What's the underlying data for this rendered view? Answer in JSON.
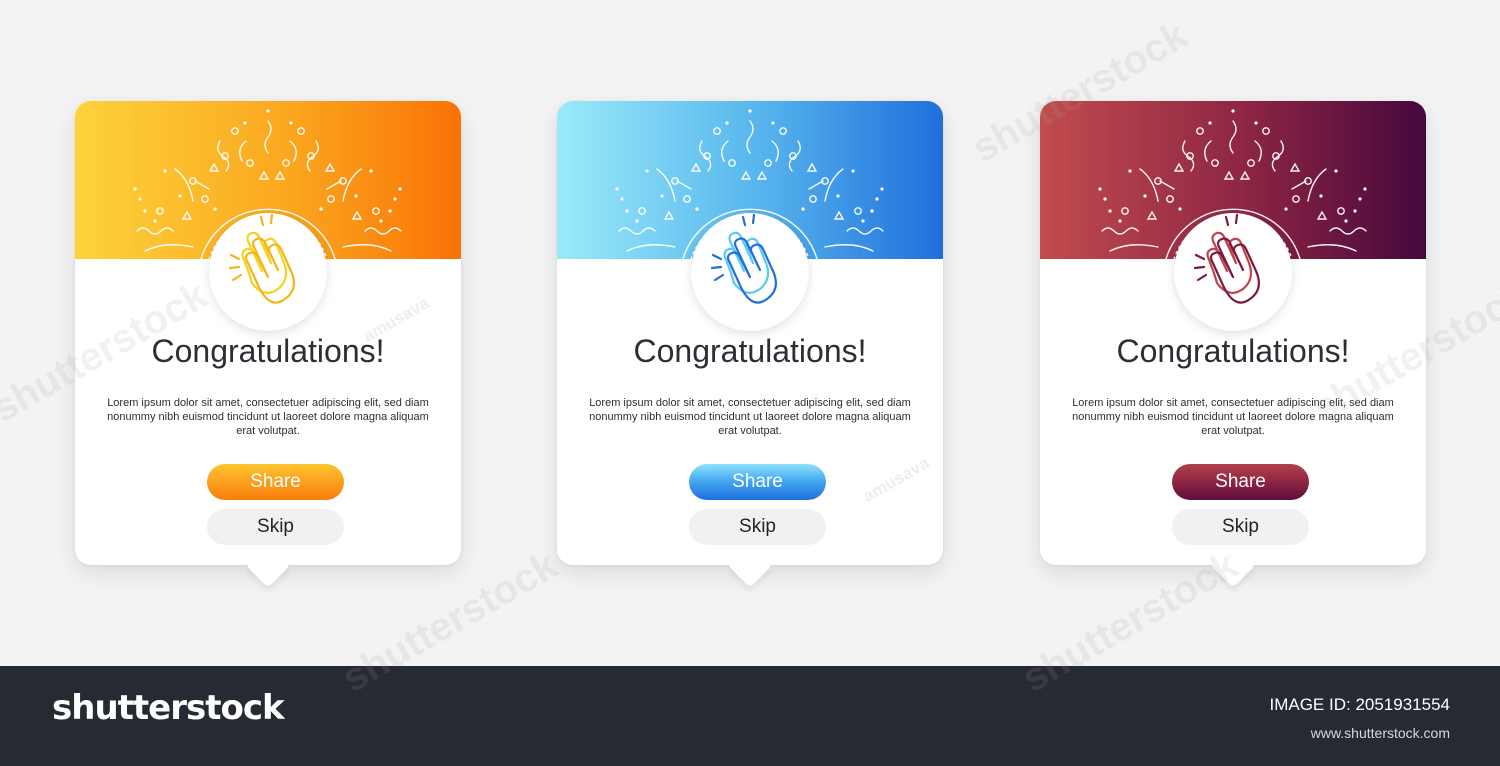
{
  "cards": [
    {
      "theme": "orange",
      "accent_colors": [
        "#fcd33b",
        "#f97206"
      ],
      "icon": "clapping-hands-icon",
      "title": "Congratulations!",
      "description": "Lorem ipsum dolor sit amet, consectetuer adipiscing elit, sed diam nonummy nibh euismod tincidunt ut laoreet dolore magna aliquam erat volutpat.",
      "share_label": "Share",
      "skip_label": "Skip"
    },
    {
      "theme": "blue",
      "accent_colors": [
        "#9aeaf8",
        "#1f6fdc"
      ],
      "icon": "clapping-hands-icon",
      "title": "Congratulations!",
      "description": "Lorem ipsum dolor sit amet, consectetuer adipiscing elit, sed diam nonummy nibh euismod tincidunt ut laoreet dolore magna aliquam erat volutpat.",
      "share_label": "Share",
      "skip_label": "Skip"
    },
    {
      "theme": "burgundy",
      "accent_colors": [
        "#c24c4e",
        "#45083d"
      ],
      "icon": "clapping-hands-icon",
      "title": "Congratulations!",
      "description": "Lorem ipsum dolor sit amet, consectetuer adipiscing elit, sed diam nonummy nibh euismod tincidunt ut laoreet dolore magna aliquam erat volutpat.",
      "share_label": "Share",
      "skip_label": "Skip"
    }
  ],
  "watermark": {
    "text": "shutterstock",
    "small_text": "amusava"
  },
  "footer": {
    "logo": "shutterstock",
    "image_id": "IMAGE ID: 2051931554",
    "url": "www.shutterstock.com"
  }
}
